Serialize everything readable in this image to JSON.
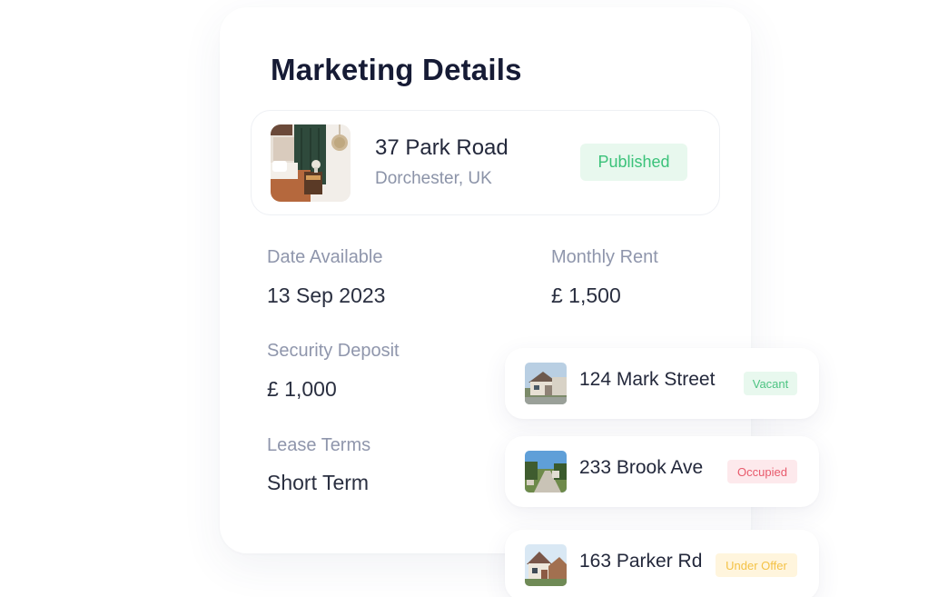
{
  "marketing_details": {
    "title": "Marketing Details",
    "property": {
      "name": "37 Park Road",
      "location": "Dorchester, UK",
      "status": "Published"
    },
    "fields": {
      "date_available": {
        "label": "Date Available",
        "value": "13 Sep 2023"
      },
      "monthly_rent": {
        "label": "Monthly Rent",
        "value": "£ 1,500"
      },
      "security_deposit": {
        "label": "Security Deposit",
        "value": "£ 1,000"
      },
      "lease_terms": {
        "label": "Lease Terms",
        "value": "Short Term"
      }
    }
  },
  "listings": [
    {
      "name": "124 Mark Street",
      "status": "Vacant"
    },
    {
      "name": "233 Brook Ave",
      "status": "Occupied"
    },
    {
      "name": "163 Parker Rd",
      "status": "Under Offer"
    }
  ],
  "colors": {
    "published": "#3bc27a",
    "vacant": "#4ec483",
    "occupied": "#e85a6c",
    "under_offer": "#f4c246",
    "title": "#161b35",
    "label": "#8f96ac"
  }
}
